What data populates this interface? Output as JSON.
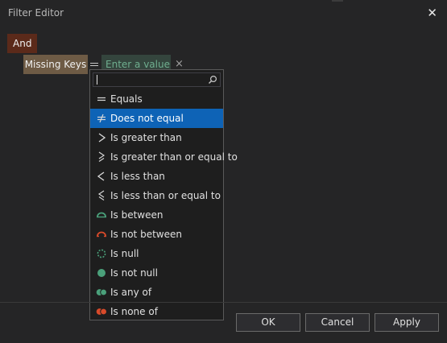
{
  "window": {
    "title": "Filter Editor",
    "close_glyph": "✕"
  },
  "filter": {
    "group_operator": "And",
    "field": "Missing Keys",
    "value_placeholder": "Enter a value...",
    "remove_glyph": "×"
  },
  "dropdown": {
    "search_value": "",
    "selected_index": 1,
    "items": [
      {
        "label": "Equals",
        "icon": "equals-icon"
      },
      {
        "label": "Does not equal",
        "icon": "not-equal-icon"
      },
      {
        "label": "Is greater than",
        "icon": "greater-than-icon"
      },
      {
        "label": "Is greater than or equal to",
        "icon": "greater-or-equal-icon"
      },
      {
        "label": "Is less than",
        "icon": "less-than-icon"
      },
      {
        "label": "Is less than or equal to",
        "icon": "less-or-equal-icon"
      },
      {
        "label": "Is between",
        "icon": "between-icon"
      },
      {
        "label": "Is not between",
        "icon": "not-between-icon"
      },
      {
        "label": "Is null",
        "icon": "null-icon"
      },
      {
        "label": "Is not null",
        "icon": "not-null-icon"
      },
      {
        "label": "Is any of",
        "icon": "any-of-icon"
      },
      {
        "label": "Is none of",
        "icon": "none-of-icon"
      }
    ]
  },
  "buttons": {
    "ok": "OK",
    "cancel": "Cancel",
    "apply": "Apply"
  },
  "colors": {
    "background": "#252526",
    "and_chip": "#5b2a1a",
    "field_chip": "#6e5b45",
    "value_chip": "#34453d",
    "selection": "#0e63b6",
    "icon_green": "#4aa07a",
    "icon_red": "#d84a2a"
  }
}
